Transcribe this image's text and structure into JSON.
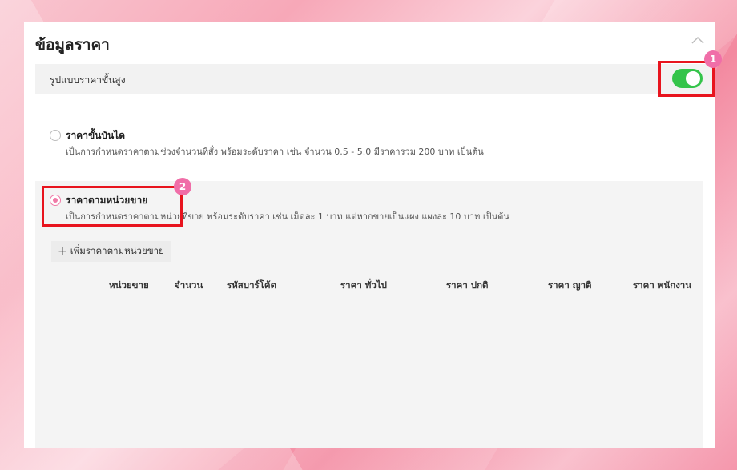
{
  "section": {
    "title": "ข้อมูลราคา",
    "collapse_icon": "chevron-up-icon"
  },
  "advanced": {
    "label": "รูปแบบราคาขั้นสูง",
    "enabled": true,
    "toggle_color": "#34c44a"
  },
  "options": [
    {
      "title": "ราคาขั้นบันได",
      "description": "เป็นการกำหนดราคาตามช่วงจำนวนที่สั่ง พร้อมระดับราคา เช่น จำนวน 0.5 - 5.0 มีราคารวม 200 บาท เป็นต้น",
      "selected": false
    },
    {
      "title": "ราคาตามหน่วยขาย",
      "description": "เป็นการกำหนดราคาตามหน่วยที่ขาย พร้อมระดับราคา เช่น เม็ดละ 1 บาท แต่หากขายเป็นแผง แผงละ 10 บาท เป็นต้น",
      "selected": true
    }
  ],
  "unit_pricing": {
    "add_button_label": "เพิ่มราคาตามหน่วยขาย",
    "columns": [
      "หน่วยขาย",
      "จำนวน",
      "รหัสบาร์โค้ด",
      "ราคา ทั่วไป",
      "ราคา ปกติ",
      "ราคา ญาติ",
      "ราคา พนักงาน"
    ],
    "rows": []
  },
  "annotations": {
    "badge_1": "1",
    "badge_2": "2",
    "highlight_color": "#e8141e",
    "badge_color": "#f06ea8"
  }
}
